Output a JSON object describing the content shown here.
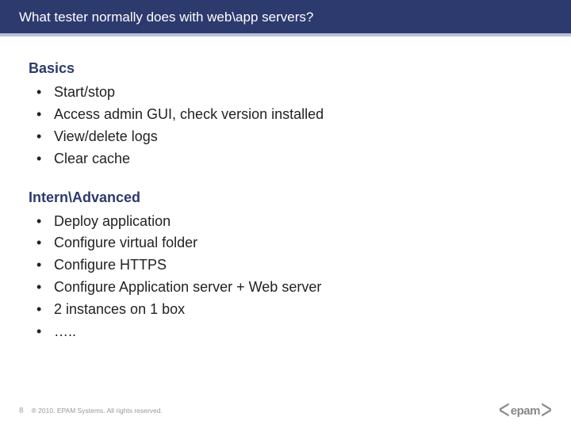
{
  "title": "What tester normally does with web\\app servers?",
  "sections": [
    {
      "heading": "Basics",
      "items": [
        "Start/stop",
        "Access admin GUI, check version installed",
        "View/delete logs",
        "Clear cache"
      ]
    },
    {
      "heading": "Intern\\Advanced",
      "items": [
        "Deploy application",
        "Configure virtual folder",
        "Configure HTTPS",
        "Configure Application server + Web server",
        "2 instances on 1 box",
        "….."
      ]
    }
  ],
  "footer": {
    "page_number": "8",
    "copyright": "® 2010. EPAM Systems. All rights reserved.",
    "logo_text": "epam"
  }
}
